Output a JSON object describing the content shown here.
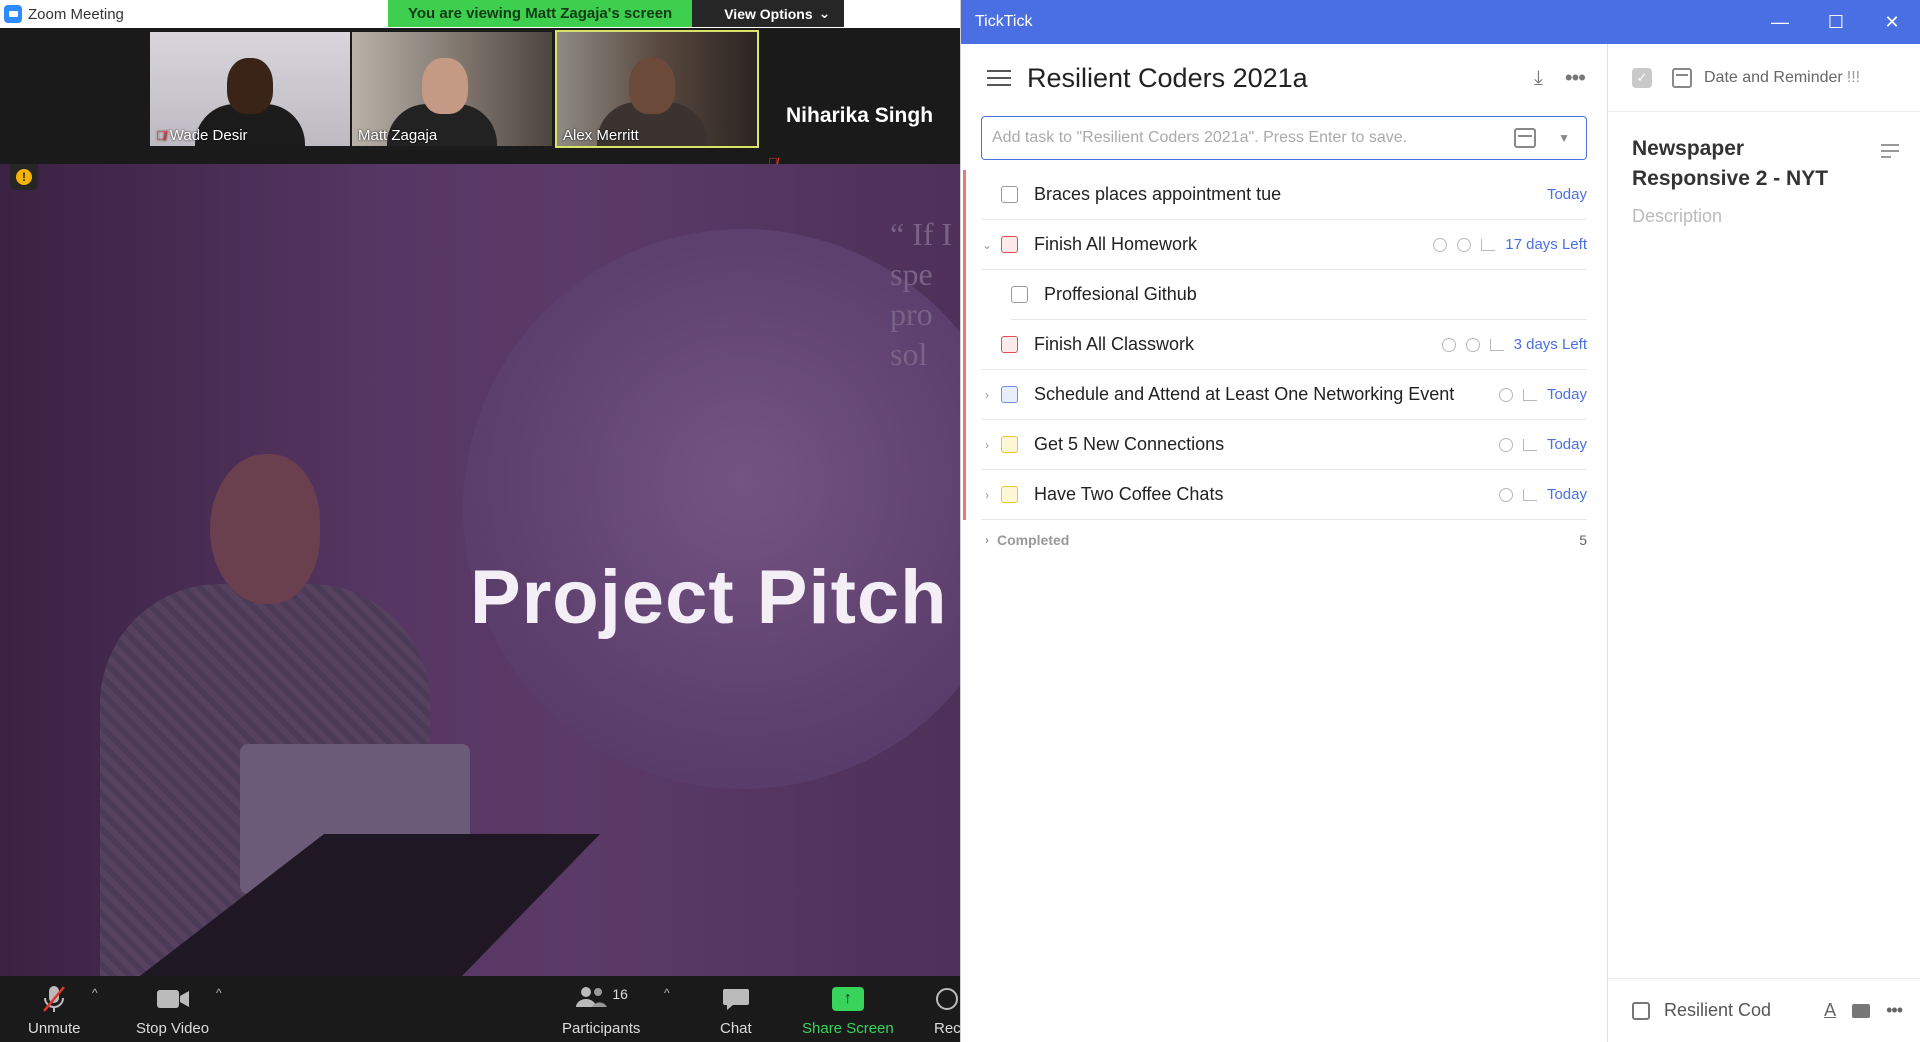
{
  "zoom": {
    "window_title": "Zoom Meeting",
    "banner_text": "You are viewing Matt Zagaja's screen",
    "view_options": "View Options",
    "participants": [
      {
        "name": "Wade Desir",
        "muted": true
      },
      {
        "name": "Matt Zagaja",
        "muted": false
      },
      {
        "name": "Alex Merritt",
        "muted": false
      },
      {
        "name": "Niharika Singh",
        "muted": true
      }
    ],
    "slide": {
      "quote_fragment": "“ If I\nspe\npro\nsol",
      "title": "Project Pitch"
    },
    "toolbar": {
      "unmute": "Unmute",
      "stop_video": "Stop Video",
      "participants": "Participants",
      "participants_count": "16",
      "chat": "Chat",
      "share_screen": "Share Screen",
      "record": "Rec"
    }
  },
  "ticktick": {
    "window_title": "TickTick",
    "list_title": "Resilient Coders 2021a",
    "add_task_placeholder": "Add task to \"Resilient Coders 2021a\". Press Enter to save.",
    "tasks": [
      {
        "title": "Braces places appointment tue",
        "due": "Today",
        "priority": "none",
        "caret": ""
      },
      {
        "title": "Finish All Homework",
        "due": "17 days Left",
        "priority": "high",
        "caret": "v"
      },
      {
        "title": "Proffesional Github",
        "due": "",
        "priority": "none",
        "caret": ""
      },
      {
        "title": "Finish All Classwork",
        "due": "3 days Left",
        "priority": "high",
        "caret": ""
      },
      {
        "title": "Schedule and Attend at Least One Networking Event",
        "due": "Today",
        "priority": "low",
        "caret": ">"
      },
      {
        "title": "Get 5 New Connections",
        "due": "Today",
        "priority": "medium",
        "caret": ">"
      },
      {
        "title": "Have Two Coffee Chats",
        "due": "Today",
        "priority": "medium",
        "caret": ">"
      }
    ],
    "completed_label": "Completed",
    "completed_count": "5",
    "detail": {
      "date_label": "Date and Reminder",
      "priority_marks": "!!!",
      "task_title": "Newspaper Responsive 2 - NYT",
      "description_placeholder": "Description",
      "project": "Resilient Cod"
    }
  }
}
